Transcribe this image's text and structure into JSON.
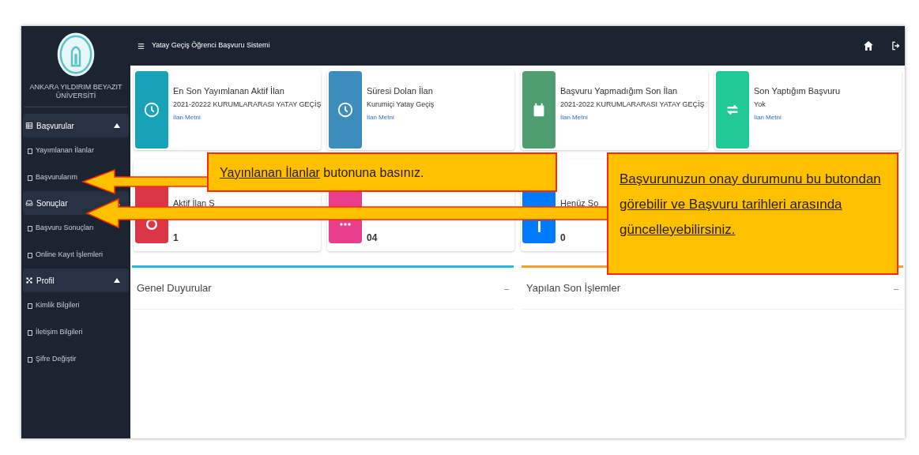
{
  "topbar": {
    "title": "Yatay Geçiş Öğrenci Başvuru Sistemi"
  },
  "sidebar": {
    "university": "ANKARA YILDIRIM BEYAZIT ÜNİVERSİTİ",
    "sections": [
      {
        "label": "Başvurular",
        "expanded": true,
        "items": [
          "Yayımlanan İlanlar",
          "Başvurularım"
        ]
      },
      {
        "label": "Sonuçlar",
        "expanded": true,
        "items": [
          "Başvuru Sonuçları",
          "Online Kayıt İşlemleri"
        ]
      },
      {
        "label": "Profil",
        "expanded": true,
        "items": [
          "Kimlik Bilgileri",
          "İletişim Bilgileri",
          "Şifre Değiştir"
        ]
      }
    ]
  },
  "cards": [
    {
      "color": "#17a2b8",
      "title": "En Son Yayımlanan Aktif İlan",
      "subtitle": "2021-20222 KURUMLARARASI YATAY GEÇİŞ",
      "link": "İlan Metni"
    },
    {
      "color": "#3c8dbc",
      "title": "Süresi Dolan İlan",
      "subtitle": "Kurumiçi Yatay Geçiş",
      "link": "İlan Metni"
    },
    {
      "color": "#4e9e72",
      "title": "Başvuru Yapmadığım Son İlan",
      "subtitle": "2021-2022 KURUMLARARASI YATAY GEÇİŞ",
      "link": "İlan Metni"
    },
    {
      "color": "#20c997",
      "title": "Son Yaptığım Başvuru",
      "subtitle": "Yok",
      "link": "İlan Metni"
    }
  ],
  "stat_cards": [
    {
      "color": "#dc3545",
      "title": "Aktif İlan S",
      "value": "1"
    },
    {
      "color": "#e83e8c",
      "value": "04"
    },
    {
      "color": "#007bff",
      "title": "Henüz So",
      "value": "0"
    }
  ],
  "panels": [
    {
      "title": "Genel Duyurular",
      "color": "#29b6e0",
      "control": "–"
    },
    {
      "title": "Yapılan Son İşlemler",
      "color": "#f0a030",
      "control": "–"
    }
  ],
  "callouts": [
    {
      "segments": [
        {
          "text": "Yayınlanan İlanlar",
          "underline": true
        },
        {
          "text": " butonuna basınız.",
          "underline": false
        }
      ]
    },
    {
      "segments": [
        {
          "text": "Başvurunuzun onay durumunu bu butondan görebilir ve Başvuru tarihleri arasında güncelleyebilirsiniz.",
          "underline": true
        }
      ]
    }
  ]
}
